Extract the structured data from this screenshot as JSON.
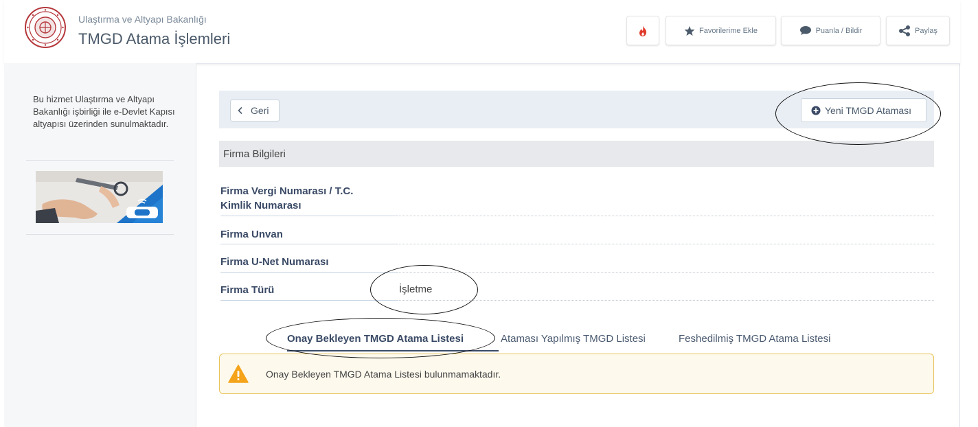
{
  "header": {
    "ministry": "Ulaştırma ve Altyapı Bakanlığı",
    "service_title": "TMGD Atama İşlemleri",
    "buttons": {
      "hot_icon": "fire-icon",
      "favorites": "Favorilerime Ekle",
      "rate": "Puanla / Bildir",
      "share": "Paylaş"
    }
  },
  "sidebar": {
    "info_text": "Bu hizmet Ulaştırma ve Altyapı Bakanlığı işbirliği ile e-Devlet Kapısı altyapısı üzerinden sunulmaktadır."
  },
  "toolbar": {
    "back_label": "Geri",
    "new_assignment_label": "Yeni TMGD Ataması"
  },
  "firm": {
    "section_title": "Firma Bilgileri",
    "fields": [
      {
        "label": "Firma Vergi Numarası / T.C. Kimlik Numarası",
        "value": ""
      },
      {
        "label": "Firma Unvan",
        "value": ""
      },
      {
        "label": "Firma U-Net Numarası",
        "value": ""
      },
      {
        "label": "Firma Türü",
        "value": "İşletme"
      }
    ]
  },
  "tabs": [
    {
      "label": "Onay Bekleyen TMGD Atama Listesi",
      "active": true
    },
    {
      "label": "Ataması Yapılmış TMGD Listesi",
      "active": false
    },
    {
      "label": "Feshedilmiş TMGD Atama Listesi",
      "active": false
    }
  ],
  "alert": {
    "message": "Onay Bekleyen TMGD Atama Listesi bulunmamaktadır.",
    "color": "#e8c35a"
  },
  "colors": {
    "accent_navy": "#3a4a66",
    "toolbar_bg": "#e9eef4",
    "fire_red": "#e03a2a"
  }
}
